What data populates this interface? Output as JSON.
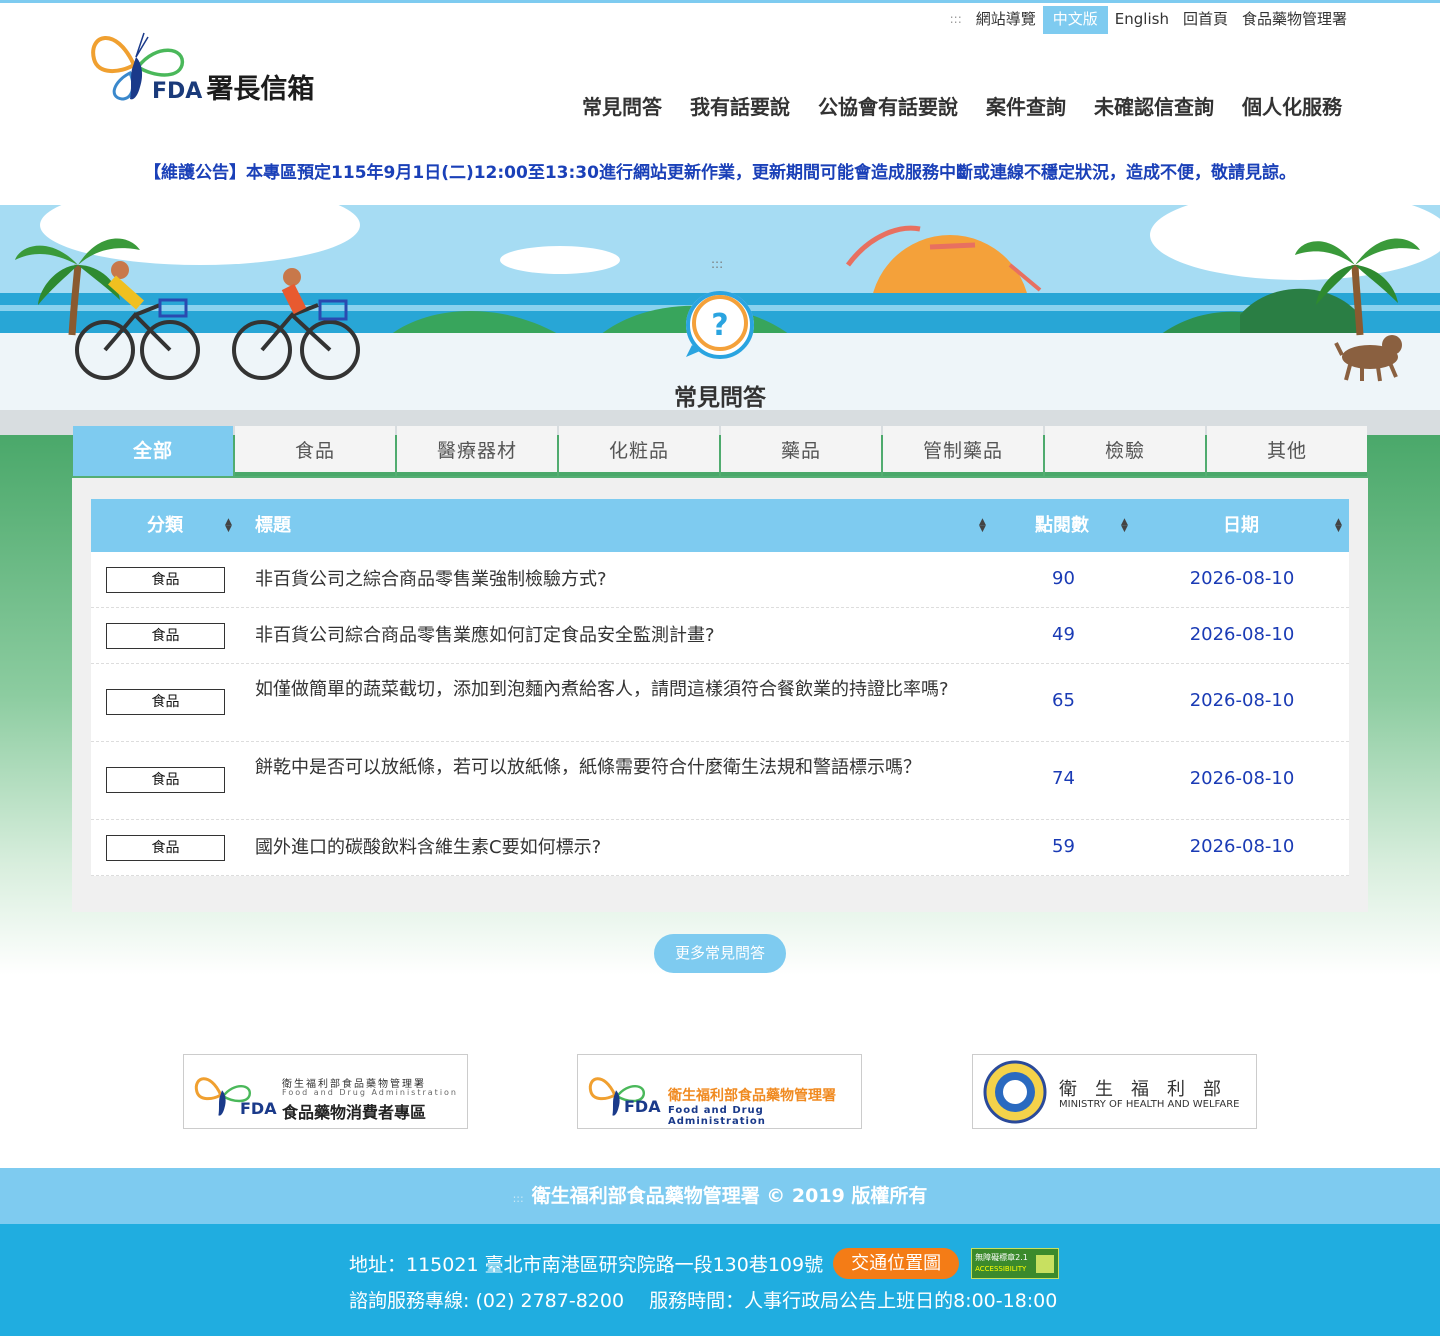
{
  "util_nav": {
    "accesskey": ":::",
    "sitemap": "網站導覽",
    "chinese": "中文版",
    "english": "English",
    "home": "回首頁",
    "fda": "食品藥物管理署"
  },
  "logo": {
    "fda": "FDA",
    "title": "署長信箱"
  },
  "main_nav": [
    "常見問答",
    "我有話要說",
    "公協會有話要說",
    "案件查詢",
    "未確認信查詢",
    "個人化服務"
  ],
  "notice": "【維護公告】本專區預定115年9月1日(二)12:00至13:30進行網站更新作業，更新期間可能會造成服務中斷或連線不穩定狀況，造成不便，敬請見諒。",
  "banner": {
    "accesskey": ":::",
    "title": "常見問答",
    "icon": "question-bubble-icon"
  },
  "tabs": [
    "全部",
    "食品",
    "醫療器材",
    "化粧品",
    "藥品",
    "管制藥品",
    "檢驗",
    "其他"
  ],
  "table": {
    "headers": {
      "category": "分類",
      "title": "標題",
      "views": "點閱數",
      "date": "日期"
    },
    "rows": [
      {
        "category": "食品",
        "title": "非百貨公司之綜合商品零售業強制檢驗方式?",
        "views": "90",
        "date": "2026-08-10"
      },
      {
        "category": "食品",
        "title": "非百貨公司綜合商品零售業應如何訂定食品安全監測計畫?",
        "views": "49",
        "date": "2026-08-10"
      },
      {
        "category": "食品",
        "title": "如僅做簡單的蔬菜截切，添加到泡麵內煮給客人，請問這樣須符合餐飲業的持證比率嗎?",
        "views": "65",
        "date": "2026-08-10"
      },
      {
        "category": "食品",
        "title": "餅乾中是否可以放紙條，若可以放紙條，紙條需要符合什麼衛生法規和警語標示嗎？",
        "views": "74",
        "date": "2026-08-10"
      },
      {
        "category": "食品",
        "title": "國外進口的碳酸飲料含維生素C要如何標示?",
        "views": "59",
        "date": "2026-08-10"
      }
    ]
  },
  "more_button": "更多常見問答",
  "partners": {
    "consumer": {
      "line1": "衛生福利部食品藥物管理署",
      "line2": "Food and Drug Administration",
      "fda": "FDA",
      "name": "食品藥物消費者專區"
    },
    "fda": {
      "fda": "FDA",
      "name": "衛生福利部食品藥物管理署",
      "en": "Food and Drug Administration"
    },
    "mohw": {
      "name": "衛　生　福　利　部",
      "en": "MINISTRY OF HEALTH AND WELFARE"
    }
  },
  "footer": {
    "accesskey": ":::",
    "copyright": "衛生福利部食品藥物管理署 © 2019 版權所有",
    "address": "地址：115021 臺北市南港區研究院路一段130巷109號",
    "map_button": "交通位置圖",
    "accessibility_badge": "無障礙標章2.1",
    "accessibility_en": "ACCESSIBILITY",
    "contact": "諮詢服務專線: (02) 2787-8200　 服務時間：人事行政局公告上班日的8:00-18:00"
  },
  "colors": {
    "accent": "#7ecbf0",
    "green": "#4aa86a",
    "link_blue": "#1a3bb5",
    "notice_blue": "#1a40b8",
    "footer_blue": "#20ade0",
    "orange": "#f47c16"
  }
}
